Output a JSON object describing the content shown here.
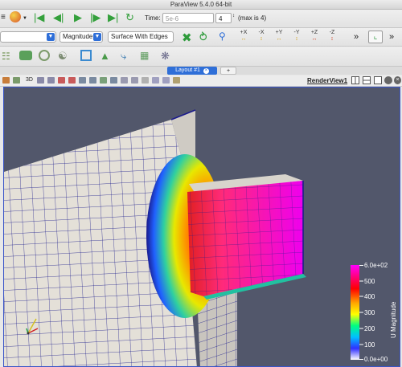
{
  "app_title": "ParaView 5.4.0 64-bit",
  "time": {
    "label": "Time:",
    "value": "5e-6",
    "step": "4",
    "max_label": "(max is 4)"
  },
  "toolbar2": {
    "color_by": "Magnitude",
    "representation": "Surface With Edges",
    "camera_buttons": [
      "+X",
      "-X",
      "+Y",
      "-Y",
      "+Z",
      "-Z"
    ]
  },
  "tabs": {
    "active": "Layout #1",
    "add": "+"
  },
  "view_toolbar": {
    "label_3d": "3D",
    "render_view": "RenderView1"
  },
  "scalar_bar": {
    "title": "U Magnitude",
    "ticks": [
      "6.0e+02",
      "500",
      "400",
      "300",
      "200",
      "100",
      "0.0e+00"
    ]
  },
  "colors": {
    "background": "#52576b",
    "mesh": "#1a1a8c",
    "accent": "#2f6fd8"
  }
}
